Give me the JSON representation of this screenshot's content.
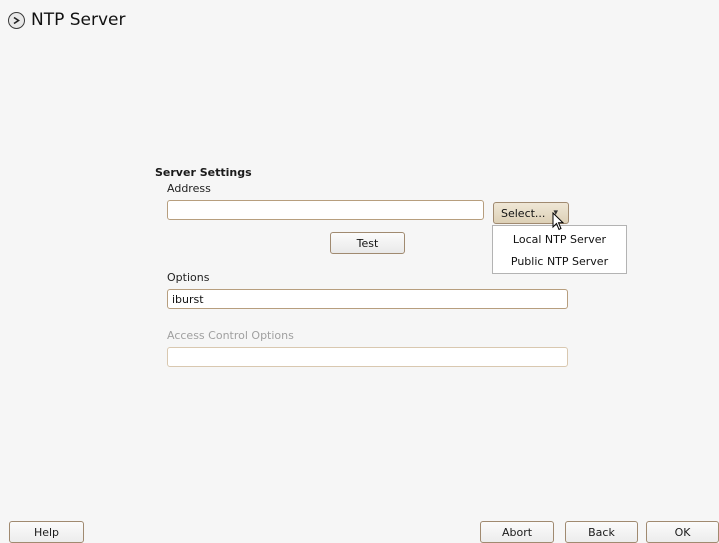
{
  "window": {
    "title": "NTP Server",
    "icon": "ntp-clock-icon"
  },
  "server_settings": {
    "heading": "Server Settings",
    "address_label": "Address",
    "address_value": "",
    "select_button": "Select...",
    "test_button": "Test",
    "options_label": "Options",
    "options_value": "iburst",
    "access_control_label": "Access Control Options",
    "access_control_value": ""
  },
  "select_menu": {
    "items": [
      "Local NTP Server",
      "Public NTP Server"
    ]
  },
  "footer": {
    "help": "Help",
    "abort": "Abort",
    "back": "Back",
    "ok": "OK"
  },
  "colors": {
    "field_border": "#b79e7e",
    "background": "#f6f6f6"
  }
}
